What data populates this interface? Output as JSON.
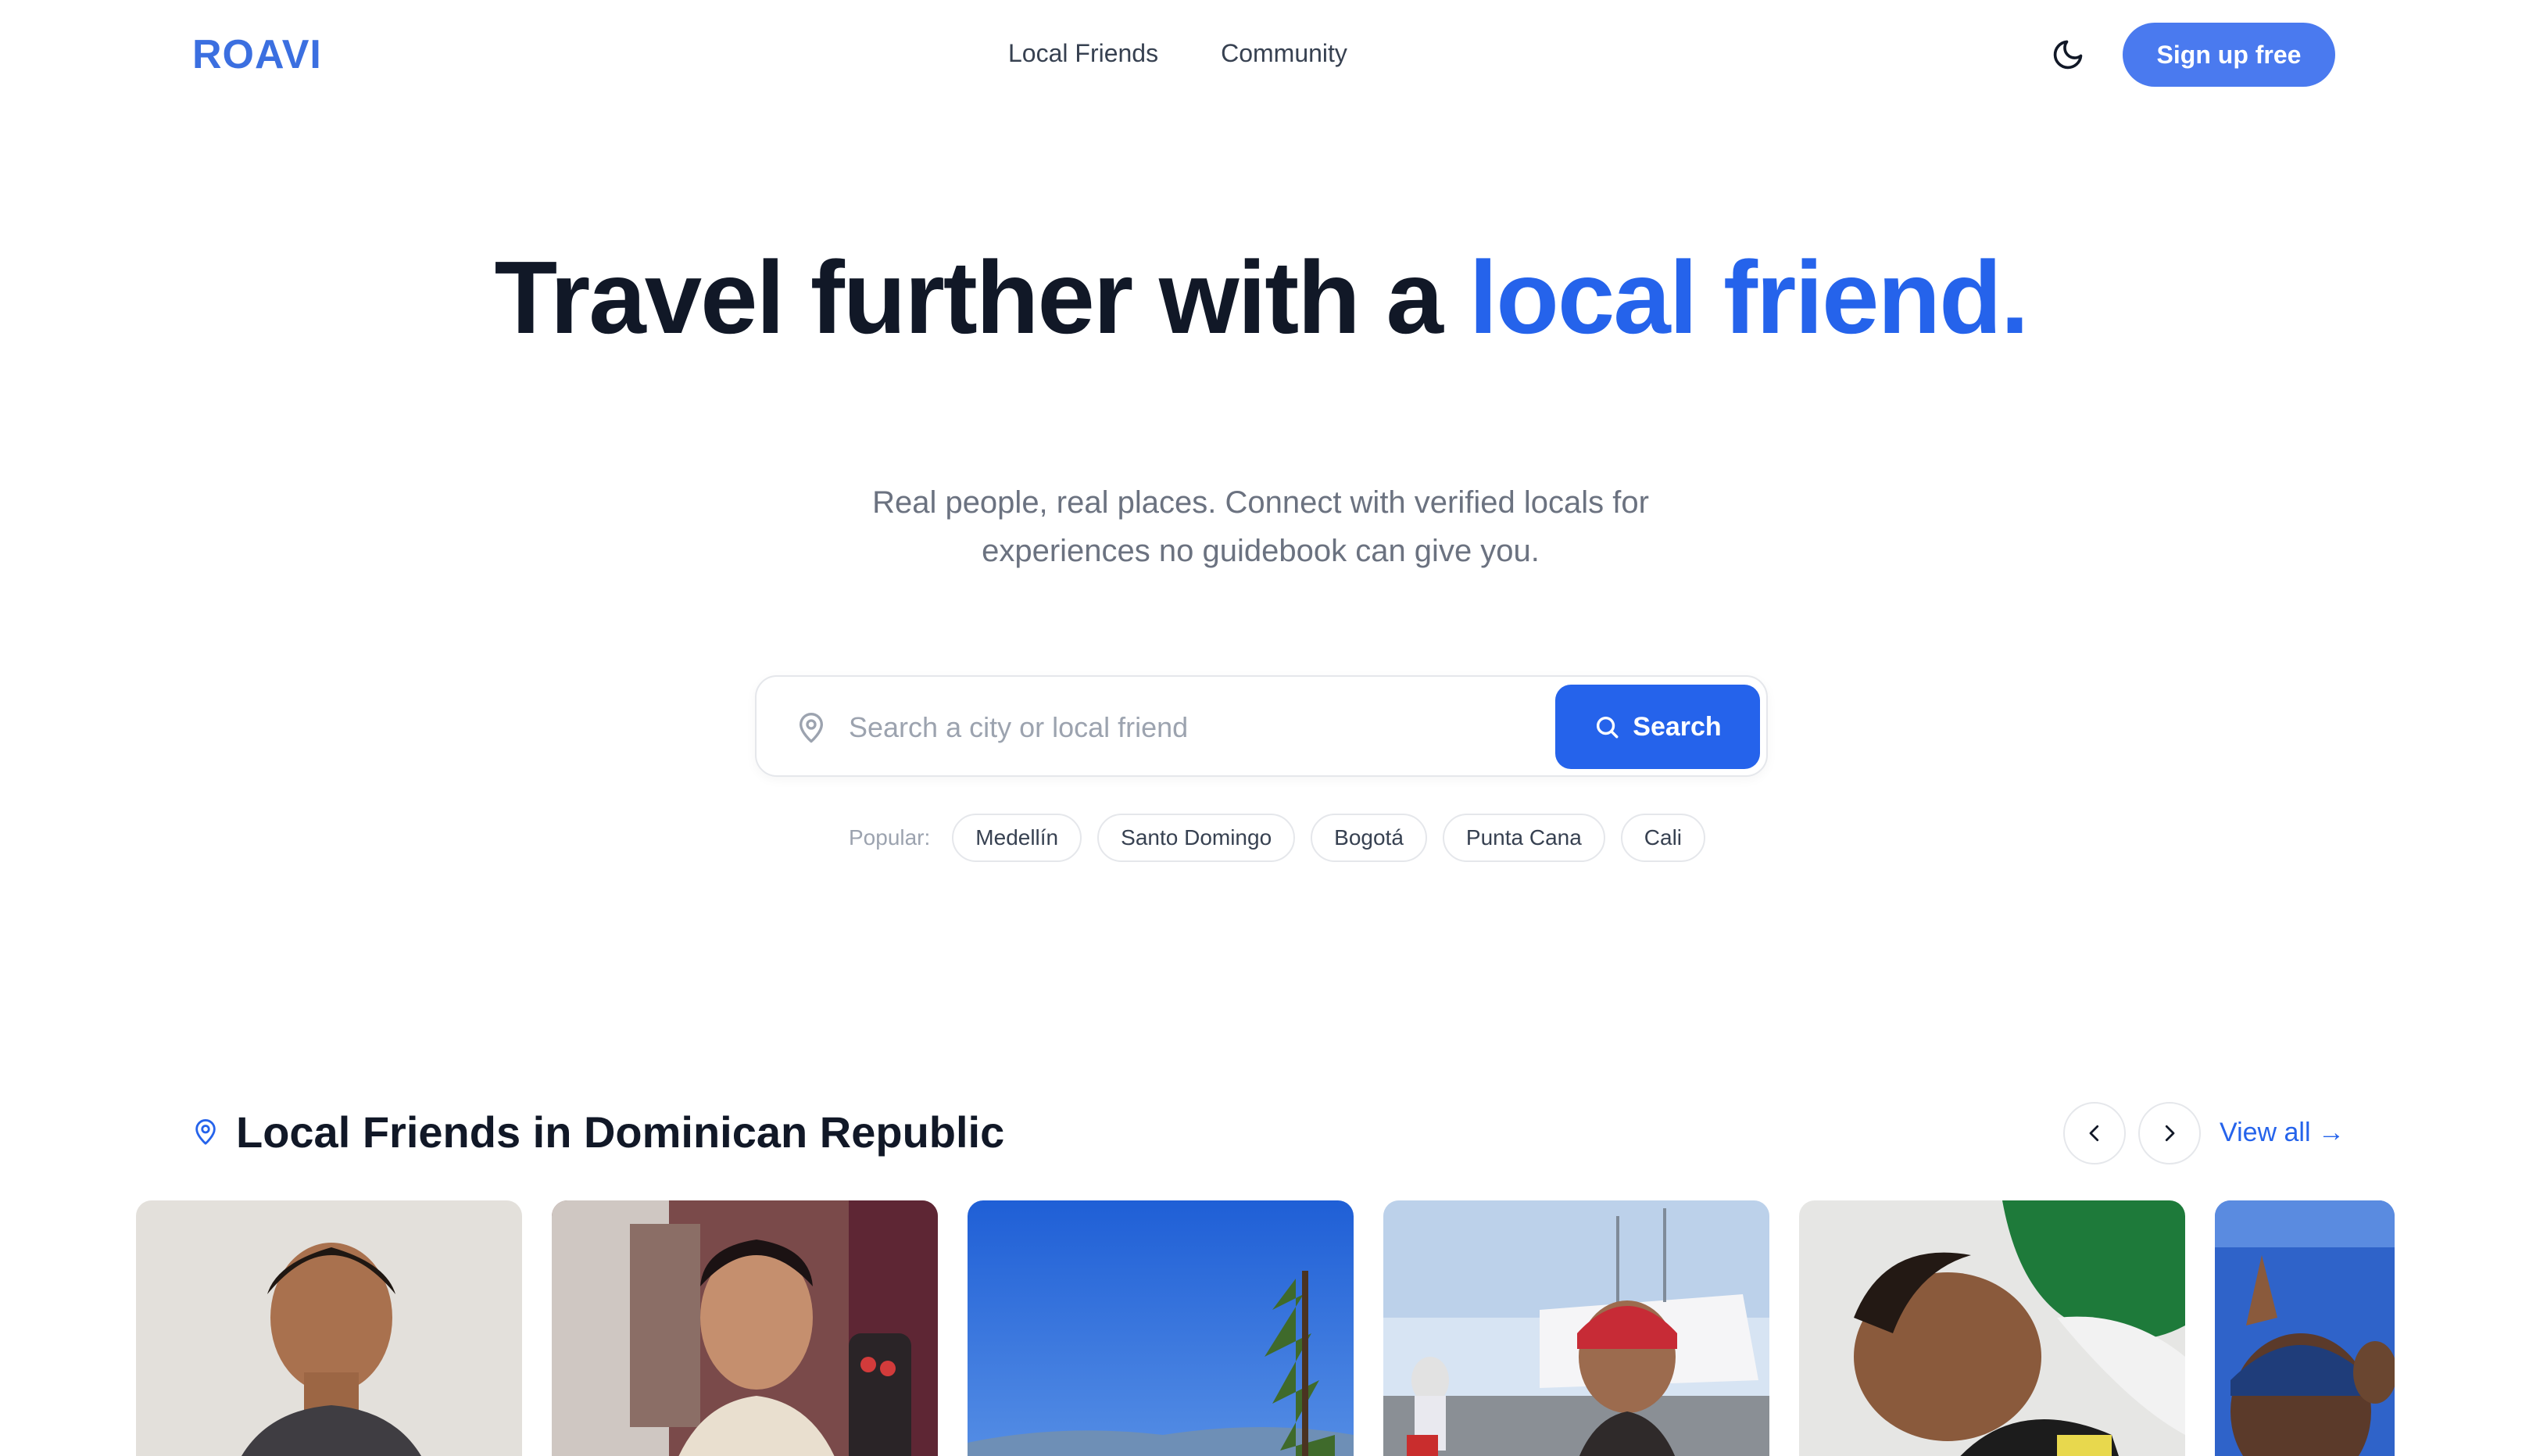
{
  "nav": {
    "logo": "ROAVI",
    "links": [
      "Local Friends",
      "Community"
    ],
    "theme_icon": "moon-icon",
    "signup_label": "Sign up free"
  },
  "hero": {
    "title_part1": "Travel further with a ",
    "title_accent": "local friend.",
    "subtitle": "Real people, real places. Connect with verified locals for experiences no guidebook can give you."
  },
  "search": {
    "placeholder": "Search a city or local friend",
    "button_label": "Search",
    "icon": "map-pin-icon"
  },
  "popular": {
    "label": "Popular:",
    "chips": [
      "Medellín",
      "Santo Domingo",
      "Bogotá",
      "Punta Cana",
      "Cali"
    ]
  },
  "section": {
    "title": "Local Friends in Dominican Republic",
    "view_all": "View all →",
    "prev_icon": "chevron-left-icon",
    "next_icon": "chevron-right-icon"
  },
  "colors": {
    "accent": "#2563eb",
    "logo": "#3b6fe0",
    "signup": "#4a7aef"
  }
}
